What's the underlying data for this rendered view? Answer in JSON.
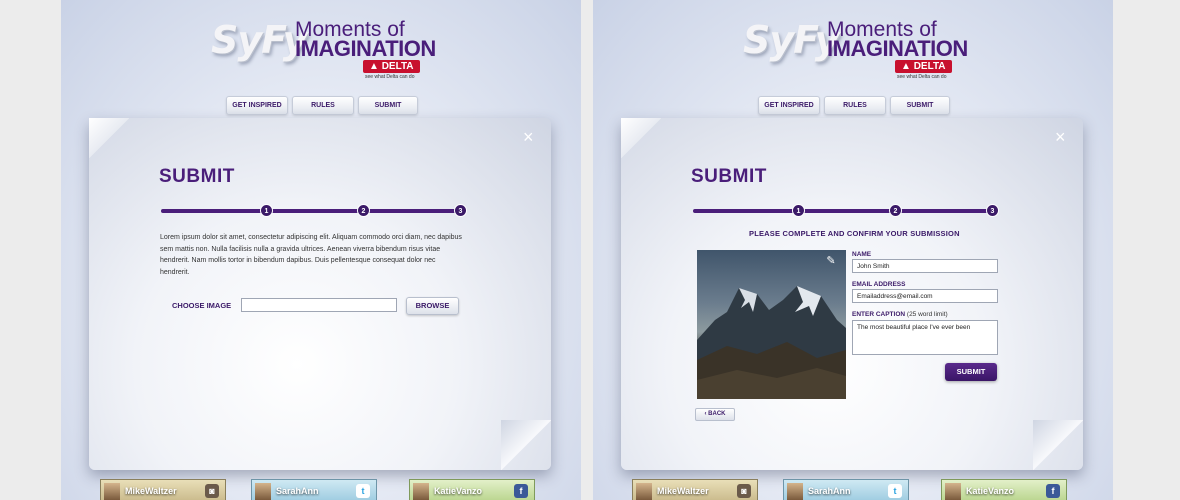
{
  "brand": {
    "syfy": "SyFy",
    "moments": "Moments of",
    "imagination": "IMAGINATION",
    "delta": "DELTA",
    "delta_tagline": "see what Delta can do"
  },
  "nav": {
    "items": [
      "GET INSPIRED",
      "RULES",
      "SUBMIT"
    ]
  },
  "close_glyph": "×",
  "left": {
    "title": "SUBMIT",
    "steps": [
      "1",
      "2",
      "3"
    ],
    "body": "Lorem ipsum dolor sit amet, consectetur adipiscing elit. Aliquam commodo orci diam, nec dapibus sem mattis non. Nulla facilisis nulla a gravida ultrices. Aenean viverra bibendum risus vitae hendrerit. Nam mollis tortor in bibendum dapibus. Duis pellentesque consequat dolor nec hendrerit.",
    "choose_image_label": "CHOOSE IMAGE",
    "file_value": "",
    "browse_label": "BROWSE"
  },
  "right": {
    "title": "SUBMIT",
    "steps": [
      "1",
      "2",
      "3"
    ],
    "heading": "PLEASE COMPLETE AND CONFIRM YOUR SUBMISSION",
    "name_label": "NAME",
    "name_value": "John Smith",
    "email_label": "EMAIL ADDRESS",
    "email_value": "Emailaddress@email.com",
    "caption_label": "ENTER CAPTION",
    "caption_hint": "(25 word limit)",
    "caption_value": "The most beautiful place I've ever been",
    "submit_label": "SUBMIT",
    "back_label": "BACK",
    "edit_icon": "edit-icon"
  },
  "tiles": {
    "left": [
      {
        "name": "MikeWaltzer",
        "social": "instagram-icon"
      },
      {
        "name": "SarahAnn",
        "social": "twitter-icon"
      },
      {
        "name": "KatieVanzo",
        "social": "facebook-icon"
      }
    ],
    "right": [
      {
        "name": "MikeWaltzer",
        "social": "instagram-icon"
      },
      {
        "name": "SarahAnn",
        "social": "twitter-icon"
      },
      {
        "name": "KatieVanzo",
        "social": "facebook-icon"
      }
    ]
  },
  "colors": {
    "brand_purple": "#4a1e7a",
    "delta_red": "#c8102e"
  }
}
